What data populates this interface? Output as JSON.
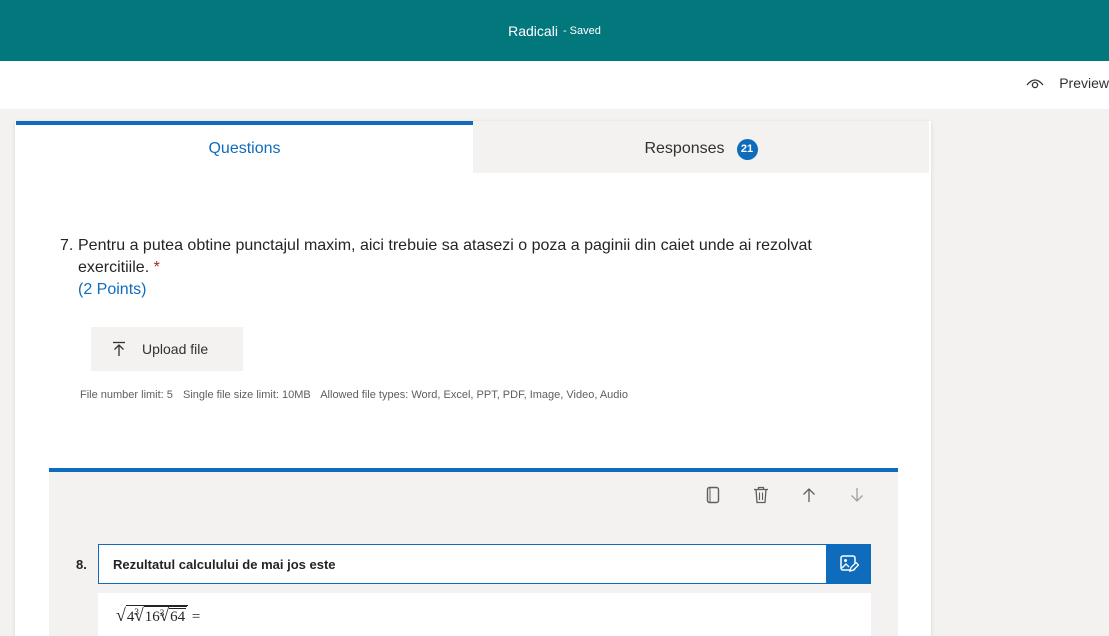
{
  "header": {
    "title": "Radicali",
    "status": "- Saved",
    "accent_color": "#03787c"
  },
  "toolbar": {
    "preview_label": "Preview",
    "preview_icon": "eye-icon"
  },
  "tabs": [
    {
      "label": "Questions",
      "active": true
    },
    {
      "label": "Responses",
      "badge": "21",
      "active": false
    }
  ],
  "question7": {
    "number": "7.",
    "text": "Pentru a putea obtine punctajul maxim, aici trebuie sa atasezi o poza a paginii din caiet unde ai rezolvat exercitiile.",
    "required_mark": "*",
    "points": "(2 Points)",
    "upload_label": "Upload file",
    "file_info": {
      "number_limit": "File number limit: 5",
      "size_limit": "Single file size limit: 10MB",
      "types": "Allowed file types: Word, Excel, PPT, PDF, Image, Video, Audio"
    }
  },
  "question8": {
    "number": "8.",
    "title_value": "Rezultatul calculului de mai jos este",
    "actions": [
      "copy-icon",
      "delete-icon",
      "move-up-icon",
      "move-down-icon"
    ],
    "formula": {
      "inner1": "4",
      "index3a": "3",
      "inner2": "16",
      "index3b": "3",
      "inner3": "64",
      "equals": "="
    }
  },
  "colors": {
    "primary": "#0f6cbd",
    "required": "#a4262c"
  }
}
